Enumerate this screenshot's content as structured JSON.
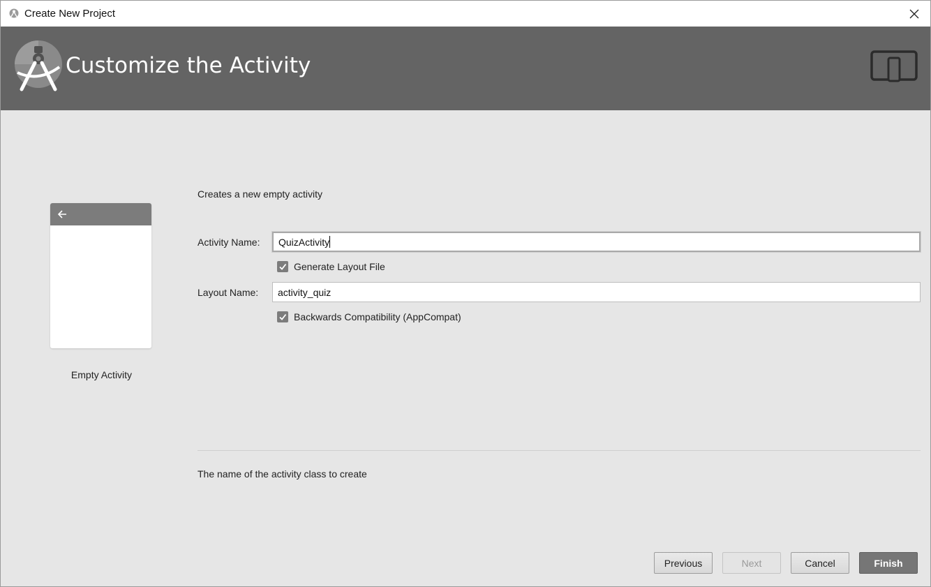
{
  "window": {
    "title": "Create New Project"
  },
  "banner": {
    "heading": "Customize the Activity"
  },
  "preview": {
    "template_name": "Empty Activity"
  },
  "form": {
    "description": "Creates a new empty activity",
    "activity_name_label": "Activity Name:",
    "activity_name_value": "QuizActivity",
    "generate_layout_label": "Generate Layout File",
    "generate_layout_checked": true,
    "layout_name_label": "Layout Name:",
    "layout_name_value": "activity_quiz",
    "backwards_compat_label": "Backwards Compatibility (AppCompat)",
    "backwards_compat_checked": true,
    "hint": "The name of the activity class to create"
  },
  "buttons": {
    "previous": "Previous",
    "next": "Next",
    "cancel": "Cancel",
    "finish": "Finish"
  },
  "icons": {
    "app": "android-studio-icon",
    "close": "close-icon",
    "logo": "android-studio-logo",
    "device": "tablet-phone-icon",
    "back_arrow": "back-arrow-icon",
    "check": "checkmark-icon"
  },
  "colors": {
    "banner": "#646464",
    "body": "#e6e6e6",
    "finish_button": "#767676"
  }
}
